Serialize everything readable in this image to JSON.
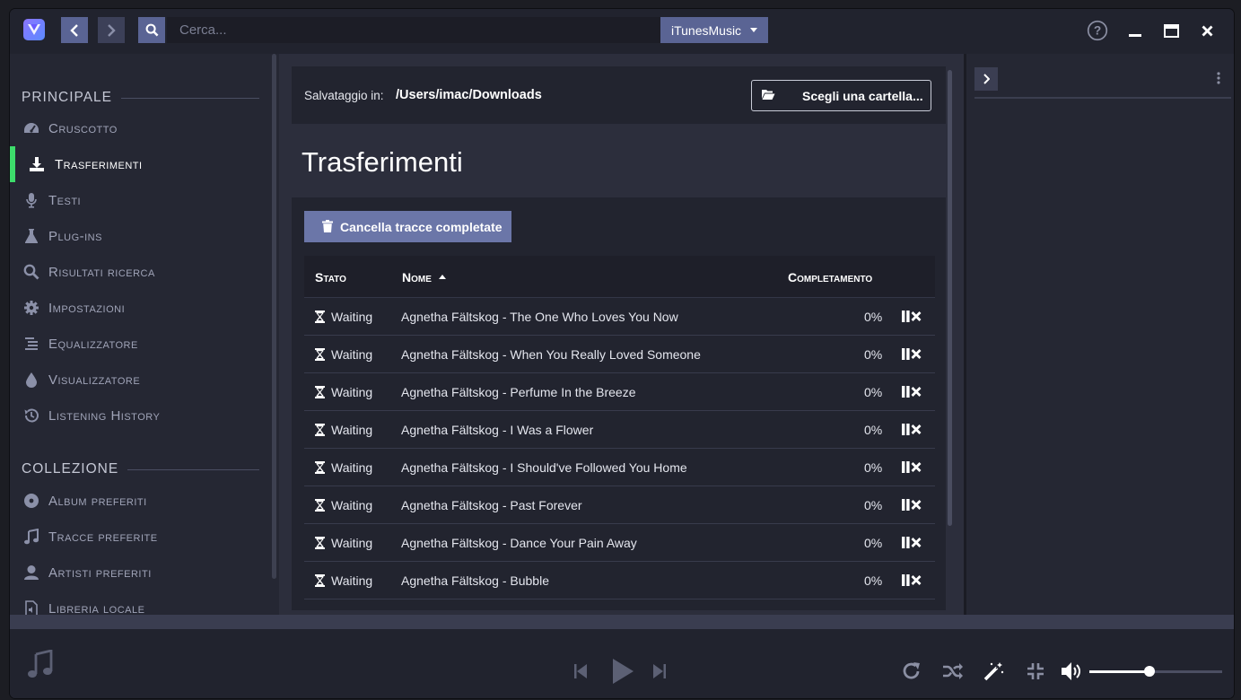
{
  "window": {
    "source_select": "iTunesMusic"
  },
  "search": {
    "placeholder": "Cerca..."
  },
  "sidebar": {
    "sections": [
      {
        "title": "PRINCIPALE"
      },
      {
        "title": "COLLEZIONE"
      }
    ],
    "main_items": [
      {
        "label": "Cruscotto",
        "icon": "dashboard-icon"
      },
      {
        "label": "Trasferimenti",
        "icon": "download-icon",
        "active": true
      },
      {
        "label": "Testi",
        "icon": "microphone-icon"
      },
      {
        "label": "Plug-ins",
        "icon": "flask-icon"
      },
      {
        "label": "Risultati ricerca",
        "icon": "search-icon"
      },
      {
        "label": "Impostazioni",
        "icon": "gear-icon"
      },
      {
        "label": "Equalizzatore",
        "icon": "equalizer-icon"
      },
      {
        "label": "Visualizzatore",
        "icon": "droplet-icon"
      },
      {
        "label": "Listening History",
        "icon": "history-icon"
      }
    ],
    "collection_items": [
      {
        "label": "Album preferiti",
        "icon": "disc-icon"
      },
      {
        "label": "Tracce preferite",
        "icon": "music-note-icon"
      },
      {
        "label": "Artisti preferiti",
        "icon": "user-icon"
      },
      {
        "label": "Libreria locale",
        "icon": "file-audio-icon"
      }
    ]
  },
  "save": {
    "label": "Salvataggio in:",
    "path": "/Users/imac/Downloads",
    "button": "Scegli una cartella..."
  },
  "page": {
    "title": "Trasferimenti",
    "clear_button": "Cancella tracce completate"
  },
  "table": {
    "headers": {
      "status": "Stato",
      "name": "Nome",
      "completion": "Completamento"
    },
    "rows": [
      {
        "status": "Waiting",
        "name": "Agnetha Fältskog - The One Who Loves You Now",
        "progress": "0%"
      },
      {
        "status": "Waiting",
        "name": "Agnetha Fältskog - When You Really Loved Someone",
        "progress": "0%"
      },
      {
        "status": "Waiting",
        "name": "Agnetha Fältskog - Perfume In the Breeze",
        "progress": "0%"
      },
      {
        "status": "Waiting",
        "name": "Agnetha Fältskog - I Was a Flower",
        "progress": "0%"
      },
      {
        "status": "Waiting",
        "name": "Agnetha Fältskog - I Should've Followed You Home",
        "progress": "0%"
      },
      {
        "status": "Waiting",
        "name": "Agnetha Fältskog - Past Forever",
        "progress": "0%"
      },
      {
        "status": "Waiting",
        "name": "Agnetha Fältskog - Dance Your Pain Away",
        "progress": "0%"
      },
      {
        "status": "Waiting",
        "name": "Agnetha Fältskog - Bubble",
        "progress": "0%"
      }
    ]
  },
  "player": {
    "volume": 0.45
  },
  "colors": {
    "accent": "#5a6494",
    "active_indicator": "#3ddc6b",
    "background": "#252733"
  }
}
